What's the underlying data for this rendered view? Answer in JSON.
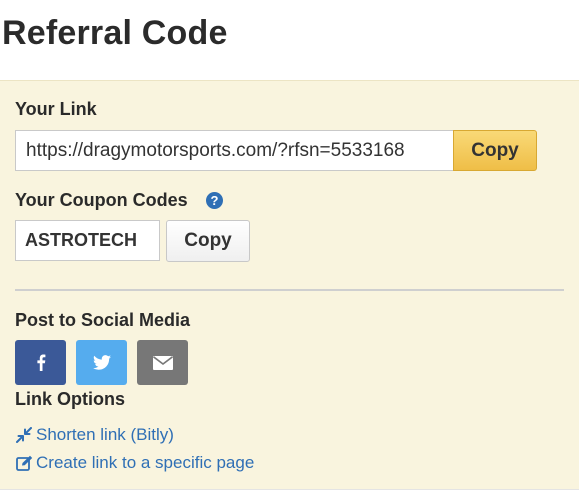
{
  "page": {
    "title": "Referral Code"
  },
  "link_section": {
    "label": "Your Link",
    "url": "https://dragymotorsports.com/?rfsn=5533168",
    "copy_label": "Copy"
  },
  "coupon_section": {
    "label": "Your Coupon Codes",
    "help_icon": "question-circle-icon",
    "help_glyph": "?",
    "code": "ASTROTECH",
    "copy_label": "Copy"
  },
  "social_section": {
    "label": "Post to Social Media",
    "buttons": [
      {
        "icon": "facebook-icon",
        "color": "#3b5998"
      },
      {
        "icon": "twitter-icon",
        "color": "#55acee"
      },
      {
        "icon": "email-icon",
        "color": "#777777"
      }
    ]
  },
  "link_options": {
    "label": "Link Options",
    "items": [
      {
        "icon": "compress-arrows-icon",
        "label": "Shorten link (Bitly)"
      },
      {
        "icon": "edit-icon",
        "label": "Create link to a specific page"
      }
    ]
  },
  "colors": {
    "panel_bg": "#f9f4de",
    "primary_button": "#efbe47",
    "link": "#2f6fb5"
  }
}
